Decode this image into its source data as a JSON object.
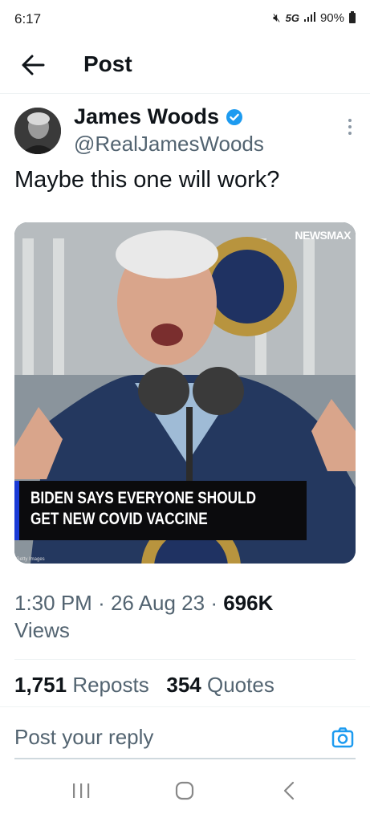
{
  "status_bar": {
    "time": "6:17",
    "network": "5G",
    "battery": "90%"
  },
  "header": {
    "title": "Post"
  },
  "author": {
    "name": "James Woods",
    "handle": "@RealJamesWoods"
  },
  "post": {
    "text": "Maybe this one will work?"
  },
  "media": {
    "network_logo": "NEWSMAX",
    "caption_line1": "BIDEN SAYS EVERYONE SHOULD",
    "caption_line2": "GET NEW COVID VACCINE",
    "credit": "Getty Images"
  },
  "meta": {
    "time": "1:30 PM",
    "date": "26 Aug 23",
    "views_count": "696K",
    "views_label": "Views"
  },
  "stats": {
    "reposts_count": "1,751",
    "reposts_label": "Reposts",
    "quotes_count": "354",
    "quotes_label": "Quotes"
  },
  "reply": {
    "placeholder": "Post your reply"
  },
  "colors": {
    "accent": "#1d9bf0",
    "caption_stripe": "#1a3bd6",
    "muted_text": "#536471"
  }
}
